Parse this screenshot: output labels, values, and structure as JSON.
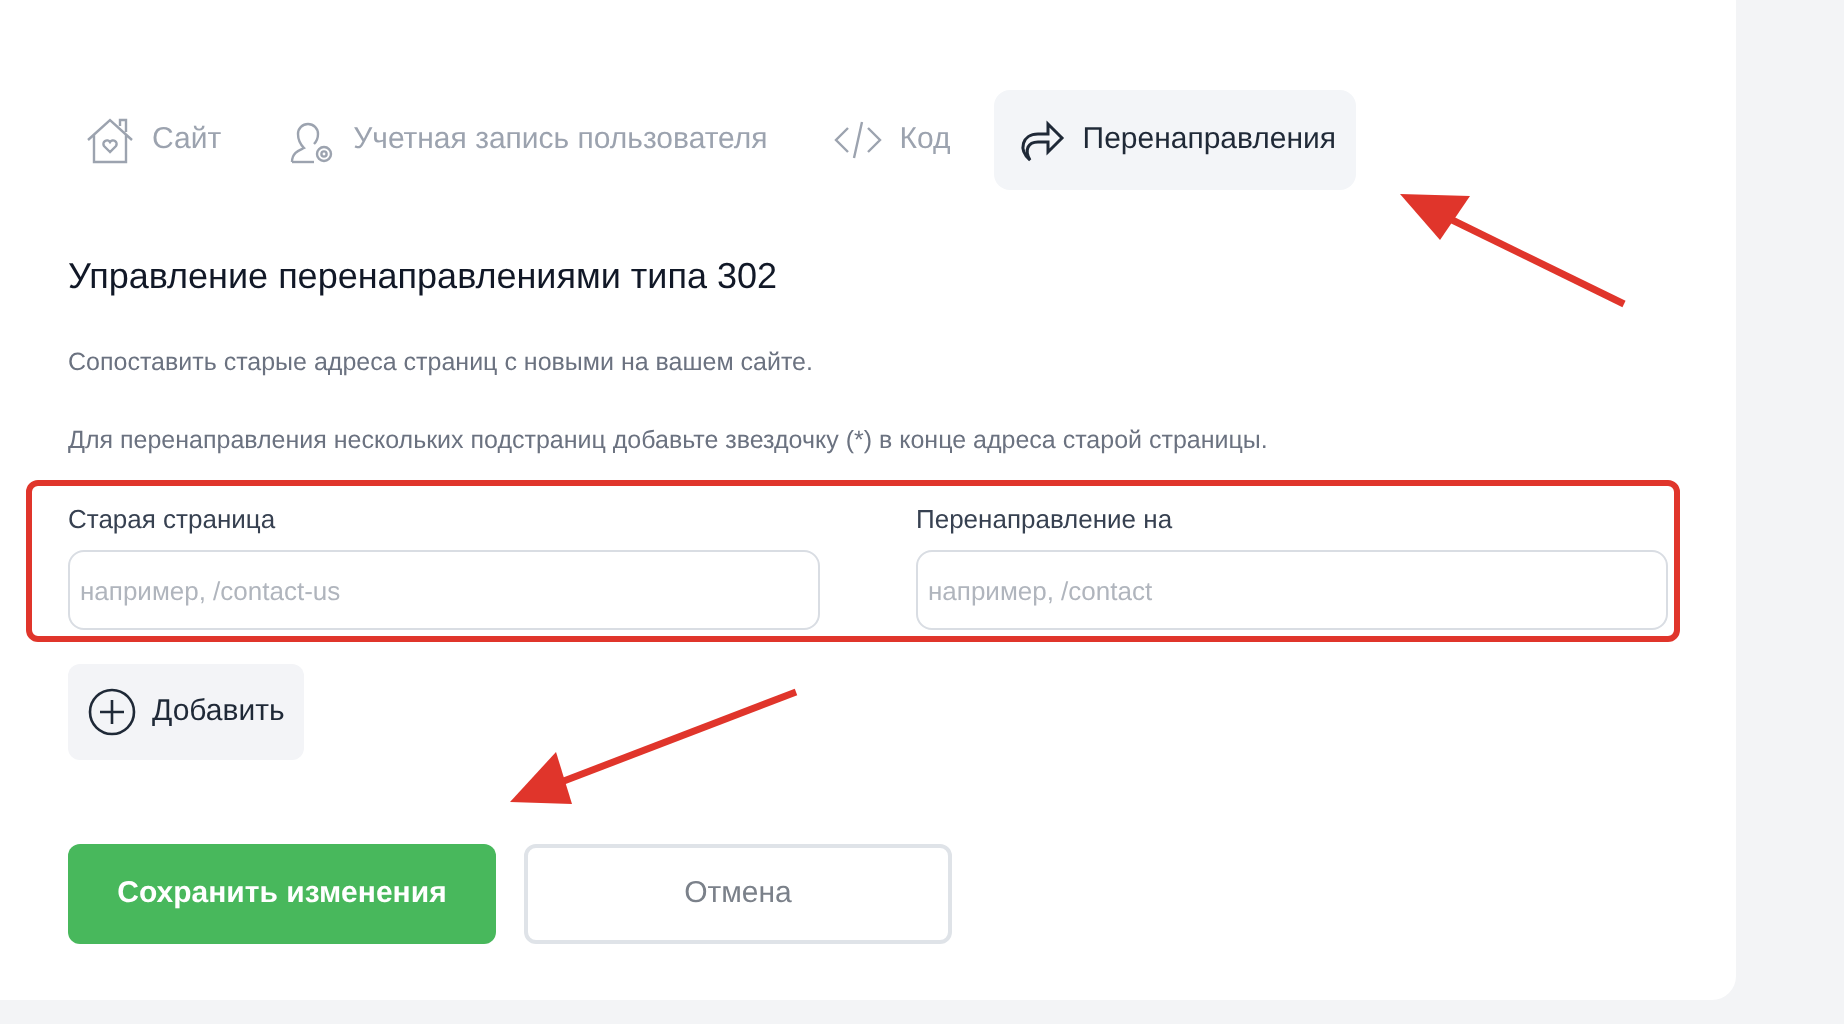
{
  "tabs": [
    {
      "label": "Сайт",
      "selected": false
    },
    {
      "label": "Учетная запись пользователя",
      "selected": false
    },
    {
      "label": "Код",
      "selected": false
    },
    {
      "label": "Перенаправления",
      "selected": true
    }
  ],
  "heading": "Управление перенаправлениями типа 302",
  "description": [
    "Сопоставить старые адреса страниц с новыми на вашем сайте.",
    "Для перенаправления нескольких подстраниц добавьте звездочку (*) в конце адреса старой страницы."
  ],
  "fields": [
    {
      "label": "Старая страница",
      "placeholder": "например, /contact-us"
    },
    {
      "label": "Перенаправление на",
      "placeholder": "например, /contact"
    }
  ],
  "add_button": "Добавить",
  "buttons": [
    {
      "label": "Сохранить изменения",
      "kind": "primary"
    },
    {
      "label": "Отмена",
      "kind": "secondary"
    }
  ]
}
